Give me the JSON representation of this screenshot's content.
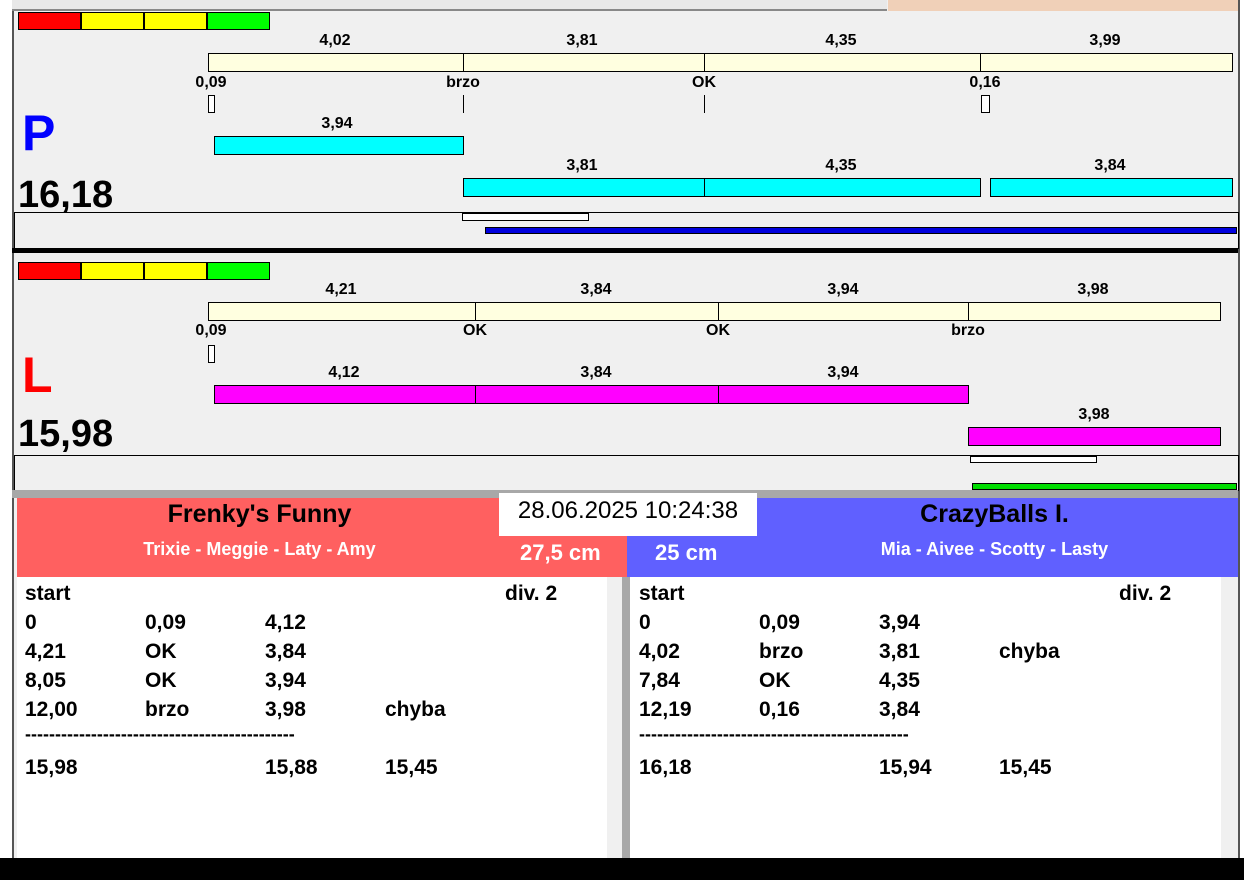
{
  "colors": {
    "cream": "#ffffe0",
    "cyan": "#00ffff",
    "magenta": "#ff00ff",
    "red_team": "#ff6060",
    "blue_team": "#6060ff"
  },
  "lanes": [
    {
      "side": "P",
      "total": "16,18",
      "top": [
        "4,02",
        "3,81",
        "4,35",
        "3,99"
      ],
      "marks": [
        "0,09",
        "brzo",
        "OK",
        "0,16"
      ],
      "run1": "3,94",
      "run2": [
        "3,81",
        "4,35",
        "3,84"
      ]
    },
    {
      "side": "L",
      "total": "15,98",
      "top": [
        "4,21",
        "3,84",
        "3,94",
        "3,98"
      ],
      "marks": [
        "0,09",
        "OK",
        "OK",
        "brzo"
      ],
      "run1": [
        "4,12",
        "3,84",
        "3,94"
      ],
      "run2": "3,98"
    }
  ],
  "datetime": "28.06.2025 10:24:38",
  "teams": [
    {
      "name": "Frenky's Funny",
      "players": "Trixie - Meggie - Laty - Amy",
      "height": "27,5 cm",
      "log": {
        "start": "start",
        "div": "div.  2",
        "rows": [
          [
            "0",
            "0,09",
            "4,12",
            ""
          ],
          [
            "4,21",
            "OK",
            "3,84",
            ""
          ],
          [
            "8,05",
            "OK",
            "3,94",
            ""
          ],
          [
            "12,00",
            "brzo",
            "3,98",
            "chyba"
          ]
        ],
        "sep": "---------------------------------------------",
        "totals": [
          "15,98",
          "",
          "15,88",
          "15,45"
        ]
      }
    },
    {
      "name": "CrazyBalls I.",
      "players": "Mia - Aivee - Scotty - Lasty",
      "height": "25 cm",
      "log": {
        "start": "start",
        "div": "div.  2",
        "rows": [
          [
            "0",
            "0,09",
            "3,94",
            ""
          ],
          [
            "4,02",
            "brzo",
            "3,81",
            "chyba"
          ],
          [
            "7,84",
            "OK",
            "4,35",
            ""
          ],
          [
            "12,19",
            "0,16",
            "3,84",
            ""
          ]
        ],
        "sep": "---------------------------------------------",
        "totals": [
          "16,18",
          "",
          "15,94",
          "15,45"
        ]
      }
    }
  ]
}
